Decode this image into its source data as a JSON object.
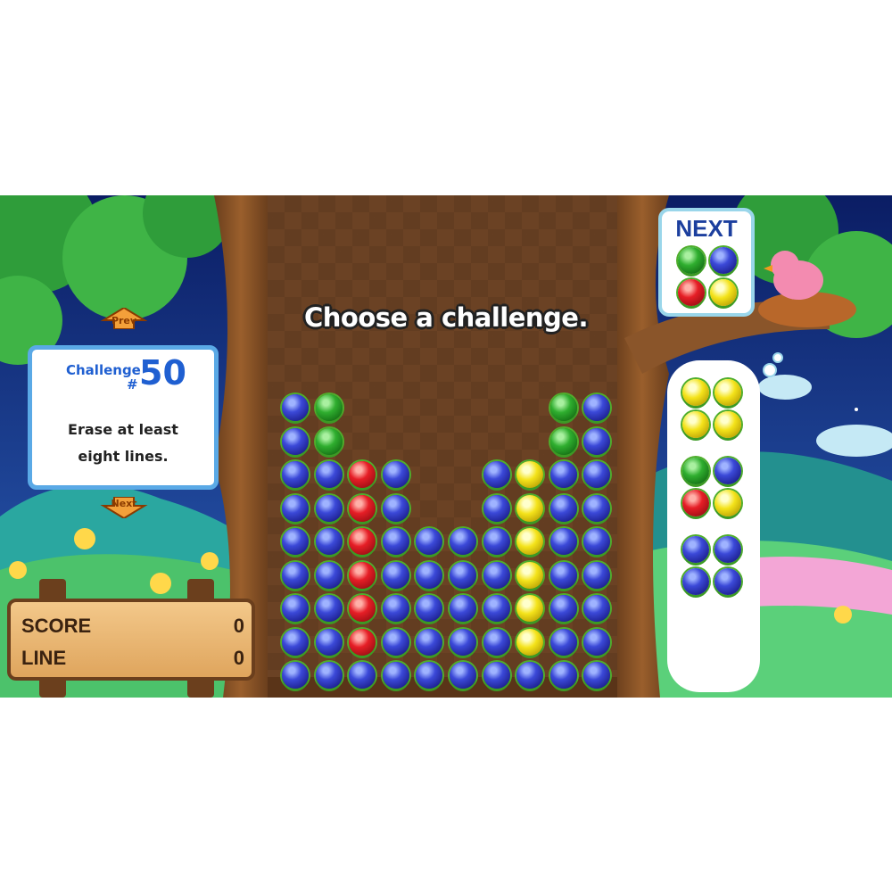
{
  "banner": {
    "text": "Choose a challenge."
  },
  "challenge_panel": {
    "label": "Challenge",
    "hash": "#",
    "number": "50",
    "line1": "Erase at least",
    "line2": "eight lines."
  },
  "nav": {
    "prev_label": "Prev",
    "next_label": "Next"
  },
  "next_box": {
    "label": "NEXT",
    "pieces": [
      "green",
      "blue",
      "red",
      "yellow"
    ]
  },
  "queue": [
    [
      "yellow",
      "yellow",
      "yellow",
      "yellow"
    ],
    [
      "green",
      "blue",
      "red",
      "yellow"
    ],
    [
      "blue",
      "blue",
      "blue",
      "blue"
    ]
  ],
  "scoreboard": {
    "score_label": "SCORE",
    "score_value": "0",
    "line_label": "LINE",
    "line_value": "0"
  },
  "board": {
    "columns": 10,
    "rows": [
      [
        "blue",
        "green",
        null,
        null,
        null,
        null,
        null,
        null,
        "green",
        "blue"
      ],
      [
        "blue",
        "green",
        null,
        null,
        null,
        null,
        null,
        null,
        "green",
        "blue"
      ],
      [
        "blue",
        "blue",
        "red",
        "blue",
        null,
        null,
        "blue",
        "yellow",
        "blue",
        "blue"
      ],
      [
        "blue",
        "blue",
        "red",
        "blue",
        null,
        null,
        "blue",
        "yellow",
        "blue",
        "blue"
      ],
      [
        "blue",
        "blue",
        "red",
        "blue",
        "blue",
        "blue",
        "blue",
        "yellow",
        "blue",
        "blue"
      ],
      [
        "blue",
        "blue",
        "red",
        "blue",
        "blue",
        "blue",
        "blue",
        "yellow",
        "blue",
        "blue"
      ],
      [
        "blue",
        "blue",
        "red",
        "blue",
        "blue",
        "blue",
        "blue",
        "yellow",
        "blue",
        "blue"
      ],
      [
        "blue",
        "blue",
        "red",
        "blue",
        "blue",
        "blue",
        "blue",
        "yellow",
        "blue",
        "blue"
      ],
      [
        "blue",
        "blue",
        "blue",
        "blue",
        "blue",
        "blue",
        "blue",
        "blue",
        "blue",
        "blue"
      ]
    ]
  },
  "colors": {
    "panel_border": "#5aa9e6",
    "challenge_number": "#1f5fd1",
    "board_wood": "#6b4224"
  }
}
